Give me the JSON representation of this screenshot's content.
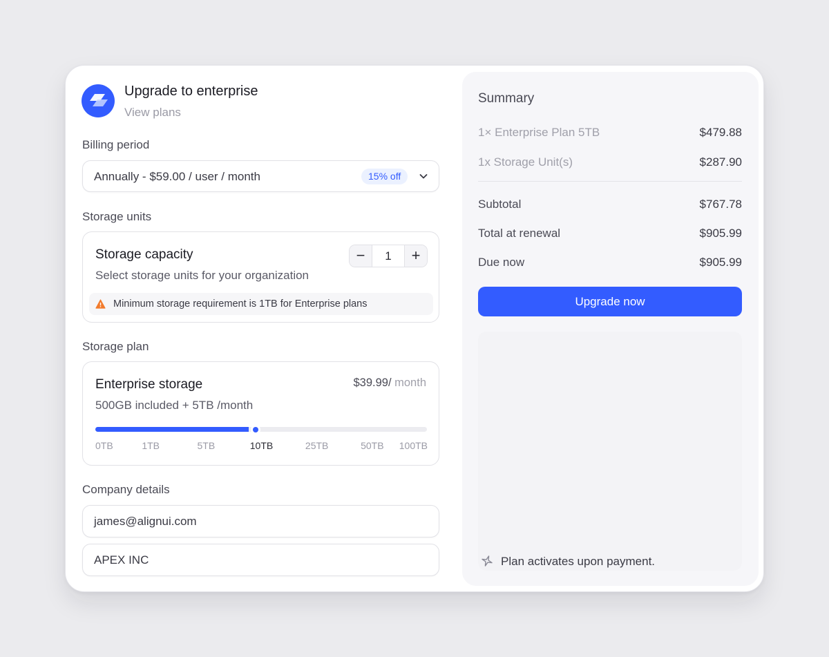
{
  "header": {
    "title": "Upgrade to enterprise",
    "subtitle": "View plans"
  },
  "billing": {
    "label": "Billing period",
    "selected": "Annually - $59.00 / user / month",
    "badge": "15% off"
  },
  "storage_units": {
    "label": "Storage units",
    "title": "Storage capacity",
    "description": "Select storage units for your organization",
    "quantity": "1",
    "minus": "−",
    "plus": "+",
    "notice": "Minimum storage requirement is 1TB for Enterprise plans"
  },
  "storage_plan": {
    "label": "Storage plan",
    "title": "Enterprise storage",
    "price": "$39.99/",
    "price_unit": " month",
    "description": "500GB included + 5TB /month",
    "slider_fraction": 0.475,
    "ticks": [
      "0TB",
      "1TB",
      "5TB",
      "10TB",
      "25TB",
      "50TB",
      "100TB"
    ],
    "active_tick": "10TB"
  },
  "company": {
    "label": "Company details",
    "email": "james@alignui.com",
    "name": "APEX INC"
  },
  "summary": {
    "title": "Summary",
    "lines": [
      {
        "label": "1× Enterprise Plan 5TB",
        "value": "$479.88"
      },
      {
        "label": "1x Storage Unit(s)",
        "value": "$287.90"
      }
    ],
    "totals": [
      {
        "label": "Subtotal",
        "value": "$767.78"
      },
      {
        "label": "Total at renewal",
        "value": "$905.99"
      },
      {
        "label": "Due now",
        "value": "$905.99"
      }
    ],
    "button": "Upgrade now",
    "footer": "Plan activates upon payment."
  },
  "colors": {
    "accent": "#335cff",
    "warning": "#f27b2c"
  }
}
